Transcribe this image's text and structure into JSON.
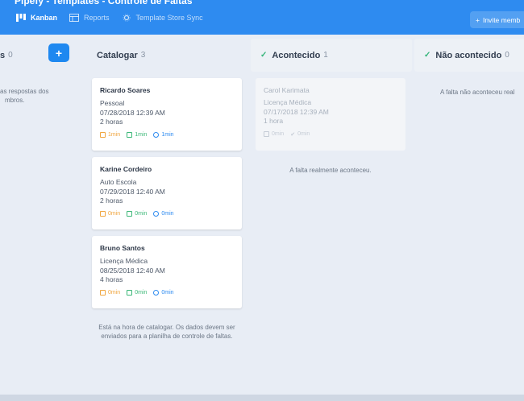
{
  "header": {
    "title": "Pipefy - Templates - Controle de Faltas",
    "nav": [
      {
        "label": "Kanban",
        "icon": "kanban-icon"
      },
      {
        "label": "Reports",
        "icon": "reports-icon"
      },
      {
        "label": "Template Store Sync",
        "icon": "sync-gear-icon"
      }
    ],
    "invite_label": "Invite memb",
    "invite_icon": "+"
  },
  "columns": {
    "col0": {
      "title_partial": "s",
      "count": "0",
      "note_line1": "as respostas dos",
      "note_line2": "mbros.",
      "add_icon": "+"
    },
    "catalogar": {
      "title": "Catalogar",
      "count": "3",
      "note": "Está na hora de catalogar. Os dados devem ser enviados para a planilha de controle de faltas."
    },
    "acontecido": {
      "title": "Acontecido",
      "count": "1",
      "note": "A falta realmente aconteceu."
    },
    "nao": {
      "title": "Não acontecido",
      "count": "0",
      "note": "A falta não aconteceu real"
    }
  },
  "cards": [
    {
      "name": "Ricardo Soares",
      "type": "Pessoal",
      "date": "07/28/2018 12:39 AM",
      "duration": "2 horas",
      "t1": "1min",
      "t2": "1min",
      "t3": "1min"
    },
    {
      "name": "Karine Cordeiro",
      "type": "Auto Escola",
      "date": "07/29/2018 12:40 AM",
      "duration": "2 horas",
      "t1": "0min",
      "t2": "0min",
      "t3": "0min"
    },
    {
      "name": "Bruno Santos",
      "type": "Licença Médica",
      "date": "08/25/2018 12:40 AM",
      "duration": "4 horas",
      "t1": "0min",
      "t2": "0min",
      "t3": "0min"
    },
    {
      "name": "Carol Karimata",
      "type": "Licença Médica",
      "date": "07/17/2018 12:39 AM",
      "duration": "1 hora",
      "t1": "0min",
      "t2": "0min"
    }
  ],
  "colors": {
    "primary": "#2e8bf0",
    "success": "#35b57a",
    "warning": "#f0a640"
  }
}
